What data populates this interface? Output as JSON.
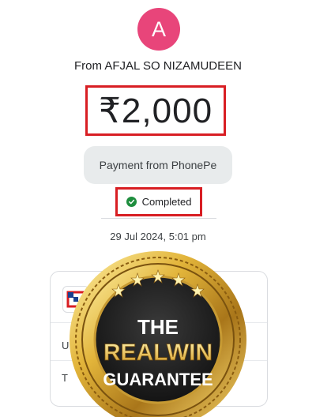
{
  "avatar": {
    "initial": "A",
    "color": "#e8457a"
  },
  "from_text": "From AFJAL SO NIZAMUDEEN",
  "amount": "₹2,000",
  "payment_source": "Payment from PhonePe",
  "status": {
    "text": "Completed",
    "icon": "check-circle-icon",
    "color": "#1e8e3e"
  },
  "date": "29 Jul 2024, 5:01 pm",
  "card": {
    "bank_icon": "bank-logo-icon",
    "row1_letter": "U",
    "row2_letter": "T"
  },
  "badge": {
    "line1": "THE",
    "line2": "REALWIN",
    "line3": "GUARANTEE"
  },
  "highlight_color": "#d81e23"
}
